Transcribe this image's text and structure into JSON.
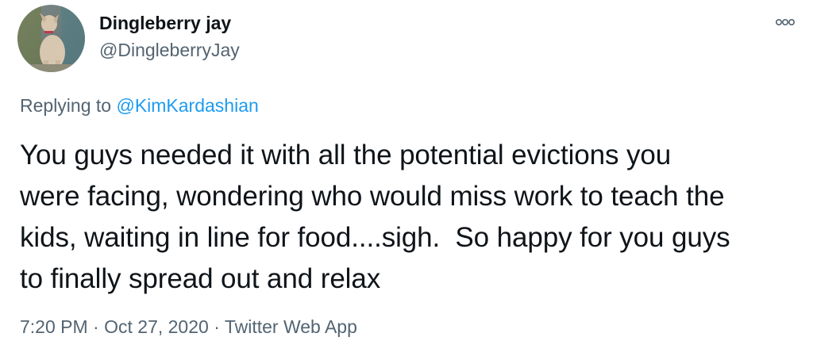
{
  "author": {
    "display_name": "Dingleberry jay",
    "handle": "@DingleberryJay",
    "avatar_icon": "dog-avatar"
  },
  "reply": {
    "prefix": "Replying to ",
    "mention": "@KimKardashian"
  },
  "tweet": {
    "lines": [
      "You guys needed it with all the potential evictions you",
      "were facing, wondering who would miss work to teach the",
      "kids, waiting in line for food....sigh.  So happy for you guys",
      "to finally spread out and relax"
    ]
  },
  "meta": {
    "time": "7:20 PM",
    "separator": " · ",
    "date": "Oct 27, 2020",
    "source": "Twitter Web App"
  },
  "colors": {
    "text": "#0f1419",
    "secondary": "#536471",
    "link": "#1d9bf0"
  },
  "icons": {
    "more": "more-options-icon"
  }
}
